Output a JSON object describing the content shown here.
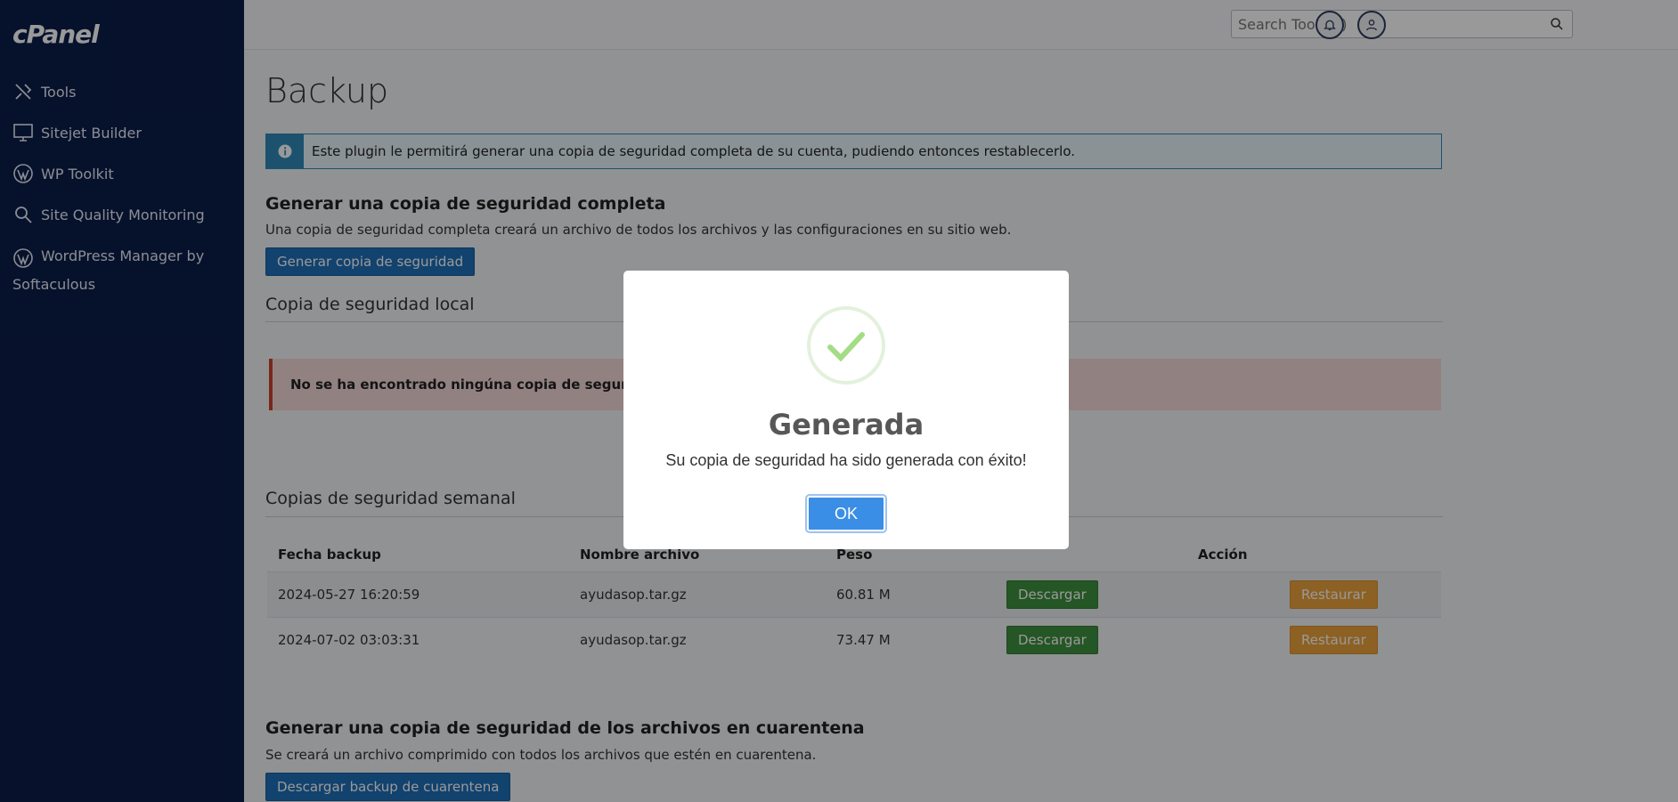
{
  "sidebar": {
    "logo": "cPanel",
    "items": [
      {
        "label": "Tools",
        "icon": "tools-icon"
      },
      {
        "label": "Sitejet Builder",
        "icon": "monitor-icon"
      },
      {
        "label": "WP Toolkit",
        "icon": "wordpress-icon"
      },
      {
        "label": "Site Quality Monitoring",
        "icon": "search-quality-icon"
      },
      {
        "label": "WordPress Manager by Softaculous",
        "icon": "wordpress-icon"
      }
    ]
  },
  "topbar": {
    "search_placeholder": "Search Tools (/)"
  },
  "page": {
    "title": "Backup",
    "info": "Este plugin le permitirá generar una copia de seguridad completa de su cuenta, pudiendo entonces restablecerlo.",
    "full_backup": {
      "heading": "Generar una copia de seguridad completa",
      "description": "Una copia de seguridad completa creará un archivo de todos los archivos y las configuraciones en su sitio web.",
      "button": "Generar copia de seguridad"
    },
    "local_backup": {
      "heading": "Copia de seguridad local",
      "alert": "No se ha encontrado ningúna copia de seguridad en su"
    },
    "weekly": {
      "heading": "Copias de seguridad semanal",
      "columns": [
        "Fecha backup",
        "Nombre archivo",
        "Peso",
        "",
        "Acción",
        ""
      ],
      "rows": [
        {
          "date": "2024-05-27 16:20:59",
          "file": "ayudasop.tar.gz",
          "size": "60.81 M",
          "download": "Descargar",
          "restore": "Restaurar"
        },
        {
          "date": "2024-07-02 03:03:31",
          "file": "ayudasop.tar.gz",
          "size": "73.47 M",
          "download": "Descargar",
          "restore": "Restaurar"
        }
      ]
    },
    "quarantine": {
      "heading": "Generar una copia de seguridad de los archivos en cuarentena",
      "description": "Se creará un archivo comprimido con todos los archivos que estén en cuarentena.",
      "button": "Descargar backup de cuarentena"
    }
  },
  "modal": {
    "title": "Generada",
    "message": "Su copia de seguridad ha sido generada con éxito!",
    "ok": "OK"
  },
  "colors": {
    "sidebar": "#0b1d4a",
    "primary": "#1e6fb7",
    "success": "#3f8f3f",
    "warning": "#e9a23b",
    "danger": "#c9412e"
  }
}
